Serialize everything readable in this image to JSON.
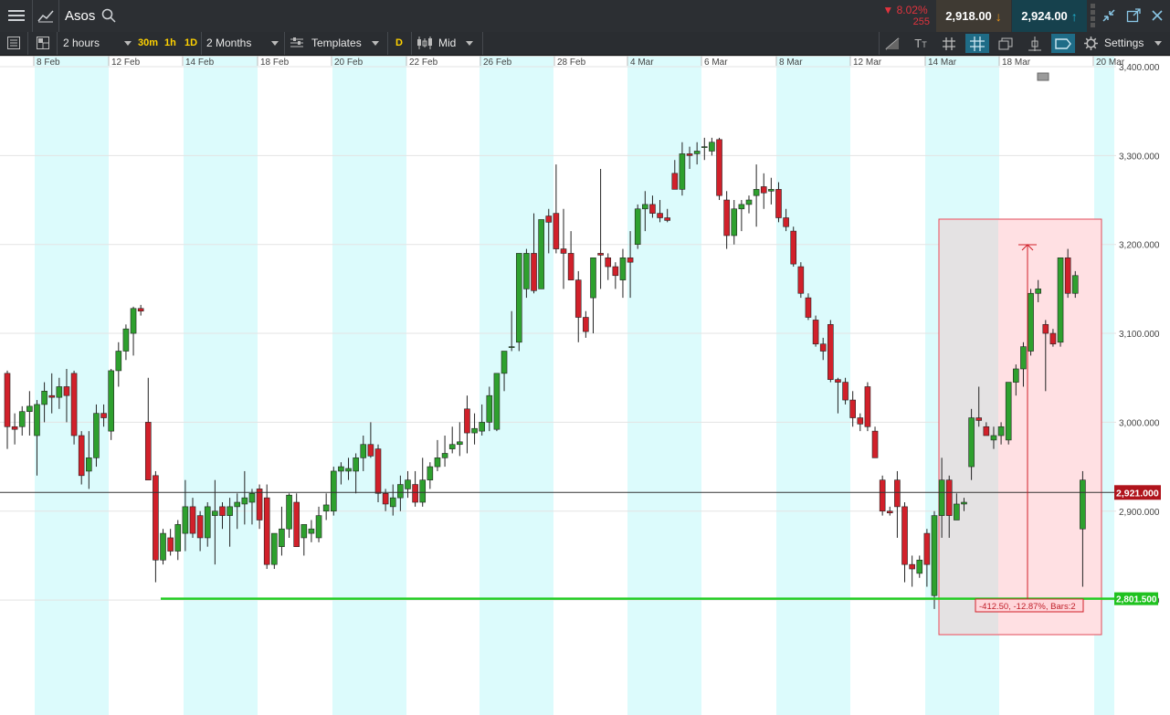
{
  "header": {
    "instrument": "Asos",
    "change_pct": "8.02%",
    "change_points": "255",
    "sell_price": "2,918.00",
    "buy_price": "2,924.00"
  },
  "toolbar": {
    "interval": "2 hours",
    "quick_intervals": [
      "30m",
      "1h",
      "1D"
    ],
    "period": "2 Months",
    "templates_label": "Templates",
    "d_badge": "D",
    "price_type": "Mid",
    "settings_label": "Settings"
  },
  "x_axis": {
    "labels": [
      "8 Feb",
      "12 Feb",
      "14 Feb",
      "18 Feb",
      "20 Feb",
      "22 Feb",
      "26 Feb",
      "28 Feb",
      "4 Mar",
      "6 Mar",
      "8 Mar",
      "12 Mar",
      "14 Mar",
      "18 Mar",
      "20 Mar"
    ]
  },
  "y_axis": {
    "labels": [
      "3,400.000",
      "3,300.000",
      "3,200.000",
      "3,100.000",
      "3,000.000",
      "2,900.000",
      "2,800.000"
    ]
  },
  "markers": {
    "current_price": "2,921.000",
    "support_level": "2,801.500",
    "measure_label": "-412.50, -12.87%, Bars:2"
  },
  "colors": {
    "up": "#2ea02e",
    "down": "#d1202a",
    "support": "#22cc22",
    "band": "#dcfbfc",
    "toolbar_bg": "#2c2f33"
  },
  "chart_data": {
    "type": "candlestick",
    "title": "Asos",
    "ylim": [
      2760,
      3410
    ],
    "x_range": [
      "7 Feb",
      "21 Mar"
    ],
    "support_level": 2801.5,
    "current_price": 2921.0,
    "candles": [
      {
        "o": 3055,
        "h": 3058,
        "l": 2970,
        "c": 2995
      },
      {
        "o": 2995,
        "h": 3010,
        "l": 2975,
        "c": 2992
      },
      {
        "o": 2995,
        "h": 3018,
        "l": 2985,
        "c": 3012
      },
      {
        "o": 3012,
        "h": 3035,
        "l": 2985,
        "c": 3018
      },
      {
        "o": 2985,
        "h": 3025,
        "l": 2940,
        "c": 3020
      },
      {
        "o": 3020,
        "h": 3045,
        "l": 3000,
        "c": 3035
      },
      {
        "o": 3030,
        "h": 3055,
        "l": 3010,
        "c": 3028
      },
      {
        "o": 3028,
        "h": 3050,
        "l": 3015,
        "c": 3040
      },
      {
        "o": 3040,
        "h": 3060,
        "l": 3000,
        "c": 3030
      },
      {
        "o": 3055,
        "h": 3058,
        "l": 2975,
        "c": 2985
      },
      {
        "o": 2985,
        "h": 2990,
        "l": 2930,
        "c": 2940
      },
      {
        "o": 2945,
        "h": 2990,
        "l": 2925,
        "c": 2960
      },
      {
        "o": 2960,
        "h": 3020,
        "l": 2950,
        "c": 3010
      },
      {
        "o": 3010,
        "h": 3020,
        "l": 2995,
        "c": 3005
      },
      {
        "o": 2990,
        "h": 3060,
        "l": 2980,
        "c": 3058
      },
      {
        "o": 3058,
        "h": 3090,
        "l": 3040,
        "c": 3080
      },
      {
        "o": 3080,
        "h": 3110,
        "l": 3070,
        "c": 3105
      },
      {
        "o": 3100,
        "h": 3130,
        "l": 3075,
        "c": 3128
      },
      {
        "o": 3128,
        "h": 3132,
        "l": 3120,
        "c": 3125
      },
      {
        "o": 3000,
        "h": 3050,
        "l": 2935,
        "c": 2935
      },
      {
        "o": 2940,
        "h": 2945,
        "l": 2820,
        "c": 2845
      },
      {
        "o": 2845,
        "h": 2880,
        "l": 2840,
        "c": 2875
      },
      {
        "o": 2870,
        "h": 2880,
        "l": 2850,
        "c": 2855
      },
      {
        "o": 2855,
        "h": 2890,
        "l": 2845,
        "c": 2885
      },
      {
        "o": 2875,
        "h": 2935,
        "l": 2855,
        "c": 2905
      },
      {
        "o": 2905,
        "h": 2915,
        "l": 2870,
        "c": 2875
      },
      {
        "o": 2895,
        "h": 2900,
        "l": 2855,
        "c": 2870
      },
      {
        "o": 2870,
        "h": 2910,
        "l": 2860,
        "c": 2905
      },
      {
        "o": 2895,
        "h": 2935,
        "l": 2840,
        "c": 2900
      },
      {
        "o": 2905,
        "h": 2910,
        "l": 2880,
        "c": 2895
      },
      {
        "o": 2895,
        "h": 2915,
        "l": 2860,
        "c": 2905
      },
      {
        "o": 2905,
        "h": 2920,
        "l": 2880,
        "c": 2910
      },
      {
        "o": 2908,
        "h": 2945,
        "l": 2885,
        "c": 2915
      },
      {
        "o": 2910,
        "h": 2925,
        "l": 2885,
        "c": 2920
      },
      {
        "o": 2925,
        "h": 2930,
        "l": 2880,
        "c": 2890
      },
      {
        "o": 2915,
        "h": 2930,
        "l": 2835,
        "c": 2840
      },
      {
        "o": 2840,
        "h": 2875,
        "l": 2835,
        "c": 2875
      },
      {
        "o": 2860,
        "h": 2905,
        "l": 2850,
        "c": 2880
      },
      {
        "o": 2880,
        "h": 2920,
        "l": 2870,
        "c": 2918
      },
      {
        "o": 2910,
        "h": 2920,
        "l": 2860,
        "c": 2860
      },
      {
        "o": 2870,
        "h": 2880,
        "l": 2850,
        "c": 2885
      },
      {
        "o": 2875,
        "h": 2890,
        "l": 2865,
        "c": 2880
      },
      {
        "o": 2870,
        "h": 2905,
        "l": 2865,
        "c": 2895
      },
      {
        "o": 2900,
        "h": 2920,
        "l": 2890,
        "c": 2907
      },
      {
        "o": 2900,
        "h": 2950,
        "l": 2895,
        "c": 2945
      },
      {
        "o": 2945,
        "h": 2955,
        "l": 2930,
        "c": 2950
      },
      {
        "o": 2945,
        "h": 2960,
        "l": 2935,
        "c": 2948
      },
      {
        "o": 2945,
        "h": 2965,
        "l": 2920,
        "c": 2960
      },
      {
        "o": 2960,
        "h": 2985,
        "l": 2945,
        "c": 2975
      },
      {
        "o": 2975,
        "h": 3000,
        "l": 2960,
        "c": 2962
      },
      {
        "o": 2970,
        "h": 2975,
        "l": 2910,
        "c": 2920
      },
      {
        "o": 2920,
        "h": 2925,
        "l": 2900,
        "c": 2908
      },
      {
        "o": 2905,
        "h": 2930,
        "l": 2895,
        "c": 2915
      },
      {
        "o": 2915,
        "h": 2940,
        "l": 2900,
        "c": 2930
      },
      {
        "o": 2925,
        "h": 2945,
        "l": 2915,
        "c": 2935
      },
      {
        "o": 2930,
        "h": 2945,
        "l": 2905,
        "c": 2910
      },
      {
        "o": 2910,
        "h": 2960,
        "l": 2905,
        "c": 2935
      },
      {
        "o": 2935,
        "h": 2955,
        "l": 2925,
        "c": 2950
      },
      {
        "o": 2950,
        "h": 2980,
        "l": 2945,
        "c": 2960
      },
      {
        "o": 2960,
        "h": 2985,
        "l": 2950,
        "c": 2965
      },
      {
        "o": 2970,
        "h": 2995,
        "l": 2965,
        "c": 2975
      },
      {
        "o": 2975,
        "h": 3000,
        "l": 2962,
        "c": 2978
      },
      {
        "o": 3015,
        "h": 3030,
        "l": 2965,
        "c": 2988
      },
      {
        "o": 2988,
        "h": 3010,
        "l": 2975,
        "c": 2993
      },
      {
        "o": 2990,
        "h": 3020,
        "l": 2985,
        "c": 3000
      },
      {
        "o": 3000,
        "h": 3040,
        "l": 2990,
        "c": 3030
      },
      {
        "o": 2992,
        "h": 3055,
        "l": 2990,
        "c": 3055
      },
      {
        "o": 3055,
        "h": 3080,
        "l": 3035,
        "c": 3080
      },
      {
        "o": 3085,
        "h": 3125,
        "l": 3080,
        "c": 3085
      },
      {
        "o": 3090,
        "h": 3190,
        "l": 3080,
        "c": 3190
      },
      {
        "o": 3150,
        "h": 3195,
        "l": 3140,
        "c": 3190
      },
      {
        "o": 3190,
        "h": 3235,
        "l": 3145,
        "c": 3148
      },
      {
        "o": 3150,
        "h": 3225,
        "l": 3150,
        "c": 3228
      },
      {
        "o": 3232,
        "h": 3240,
        "l": 3190,
        "c": 3225
      },
      {
        "o": 3235,
        "h": 3290,
        "l": 3190,
        "c": 3195
      },
      {
        "o": 3195,
        "h": 3240,
        "l": 3150,
        "c": 3190
      },
      {
        "o": 3190,
        "h": 3215,
        "l": 3180,
        "c": 3160
      },
      {
        "o": 3160,
        "h": 3170,
        "l": 3090,
        "c": 3118
      },
      {
        "o": 3118,
        "h": 3125,
        "l": 3095,
        "c": 3102
      },
      {
        "o": 3140,
        "h": 3180,
        "l": 3100,
        "c": 3185
      },
      {
        "o": 3190,
        "h": 3285,
        "l": 3150,
        "c": 3188
      },
      {
        "o": 3185,
        "h": 3190,
        "l": 3160,
        "c": 3175
      },
      {
        "o": 3175,
        "h": 3180,
        "l": 3150,
        "c": 3165
      },
      {
        "o": 3160,
        "h": 3195,
        "l": 3140,
        "c": 3185
      },
      {
        "o": 3185,
        "h": 3215,
        "l": 3140,
        "c": 3180
      },
      {
        "o": 3200,
        "h": 3245,
        "l": 3195,
        "c": 3240
      },
      {
        "o": 3240,
        "h": 3260,
        "l": 3215,
        "c": 3245
      },
      {
        "o": 3245,
        "h": 3255,
        "l": 3230,
        "c": 3235
      },
      {
        "o": 3235,
        "h": 3250,
        "l": 3225,
        "c": 3230
      },
      {
        "o": 3230,
        "h": 3240,
        "l": 3225,
        "c": 3227
      },
      {
        "o": 3280,
        "h": 3295,
        "l": 3265,
        "c": 3262
      },
      {
        "o": 3262,
        "h": 3315,
        "l": 3255,
        "c": 3302
      },
      {
        "o": 3302,
        "h": 3310,
        "l": 3285,
        "c": 3300
      },
      {
        "o": 3302,
        "h": 3315,
        "l": 3290,
        "c": 3305
      },
      {
        "o": 3310,
        "h": 3320,
        "l": 3295,
        "c": 3310
      },
      {
        "o": 3305,
        "h": 3320,
        "l": 3300,
        "c": 3315
      },
      {
        "o": 3318,
        "h": 3320,
        "l": 3250,
        "c": 3255
      },
      {
        "o": 3250,
        "h": 3260,
        "l": 3195,
        "c": 3210
      },
      {
        "o": 3210,
        "h": 3250,
        "l": 3200,
        "c": 3240
      },
      {
        "o": 3240,
        "h": 3250,
        "l": 3215,
        "c": 3245
      },
      {
        "o": 3245,
        "h": 3255,
        "l": 3235,
        "c": 3250
      },
      {
        "o": 3255,
        "h": 3290,
        "l": 3220,
        "c": 3262
      },
      {
        "o": 3265,
        "h": 3280,
        "l": 3240,
        "c": 3258
      },
      {
        "o": 3260,
        "h": 3275,
        "l": 3245,
        "c": 3262
      },
      {
        "o": 3262,
        "h": 3270,
        "l": 3225,
        "c": 3230
      },
      {
        "o": 3230,
        "h": 3240,
        "l": 3215,
        "c": 3220
      },
      {
        "o": 3215,
        "h": 3220,
        "l": 3175,
        "c": 3178
      },
      {
        "o": 3175,
        "h": 3180,
        "l": 3140,
        "c": 3145
      },
      {
        "o": 3140,
        "h": 3145,
        "l": 3115,
        "c": 3118
      },
      {
        "o": 3115,
        "h": 3120,
        "l": 3085,
        "c": 3088
      },
      {
        "o": 3088,
        "h": 3095,
        "l": 3070,
        "c": 3080
      },
      {
        "o": 3110,
        "h": 3115,
        "l": 3045,
        "c": 3048
      },
      {
        "o": 3048,
        "h": 3050,
        "l": 3010,
        "c": 3045
      },
      {
        "o": 3045,
        "h": 3050,
        "l": 3020,
        "c": 3025
      },
      {
        "o": 3025,
        "h": 3035,
        "l": 2995,
        "c": 3005
      },
      {
        "o": 3005,
        "h": 3010,
        "l": 2990,
        "c": 2998
      },
      {
        "o": 3040,
        "h": 3045,
        "l": 2990,
        "c": 2995
      },
      {
        "o": 2990,
        "h": 2995,
        "l": 2960,
        "c": 2960
      },
      {
        "o": 2935,
        "h": 2940,
        "l": 2895,
        "c": 2900
      },
      {
        "o": 2900,
        "h": 2905,
        "l": 2895,
        "c": 2898
      },
      {
        "o": 2935,
        "h": 2945,
        "l": 2870,
        "c": 2905
      },
      {
        "o": 2905,
        "h": 2910,
        "l": 2820,
        "c": 2840
      },
      {
        "o": 2840,
        "h": 2850,
        "l": 2815,
        "c": 2835
      },
      {
        "o": 2830,
        "h": 2850,
        "l": 2825,
        "c": 2845
      },
      {
        "o": 2875,
        "h": 2880,
        "l": 2815,
        "c": 2840
      },
      {
        "o": 2805,
        "h": 2900,
        "l": 2790,
        "c": 2895
      },
      {
        "o": 2895,
        "h": 2960,
        "l": 2870,
        "c": 2935
      },
      {
        "o": 2935,
        "h": 2940,
        "l": 2870,
        "c": 2895
      },
      {
        "o": 2890,
        "h": 2920,
        "l": 2890,
        "c": 2908
      },
      {
        "o": 2908,
        "h": 2915,
        "l": 2900,
        "c": 2910
      },
      {
        "o": 2950,
        "h": 3015,
        "l": 2935,
        "c": 3005
      },
      {
        "o": 3005,
        "h": 3040,
        "l": 2995,
        "c": 3002
      },
      {
        "o": 2995,
        "h": 3000,
        "l": 2985,
        "c": 2985
      },
      {
        "o": 2980,
        "h": 2995,
        "l": 2970,
        "c": 2985
      },
      {
        "o": 2985,
        "h": 3000,
        "l": 2975,
        "c": 2995
      },
      {
        "o": 2980,
        "h": 3025,
        "l": 2975,
        "c": 3045
      },
      {
        "o": 3045,
        "h": 3065,
        "l": 3030,
        "c": 3060
      },
      {
        "o": 3060,
        "h": 3090,
        "l": 3040,
        "c": 3085
      },
      {
        "o": 3080,
        "h": 3150,
        "l": 3075,
        "c": 3145
      },
      {
        "o": 3145,
        "h": 3160,
        "l": 3135,
        "c": 3150
      },
      {
        "o": 3110,
        "h": 3115,
        "l": 3035,
        "c": 3100
      },
      {
        "o": 3100,
        "h": 3105,
        "l": 3085,
        "c": 3088
      },
      {
        "o": 3090,
        "h": 3185,
        "l": 3085,
        "c": 3185
      },
      {
        "o": 3185,
        "h": 3195,
        "l": 3140,
        "c": 3145
      },
      {
        "o": 3145,
        "h": 3170,
        "l": 3140,
        "c": 3165
      },
      {
        "o": 2880,
        "h": 2945,
        "l": 2815,
        "c": 2935
      }
    ]
  }
}
